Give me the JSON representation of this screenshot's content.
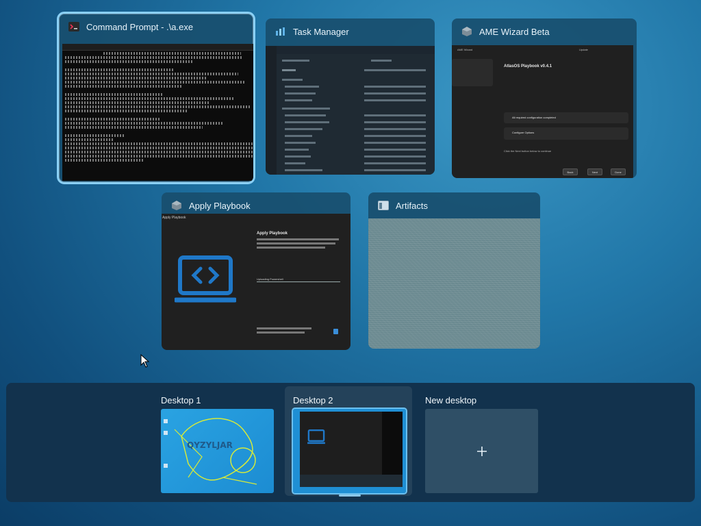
{
  "windows": {
    "cmd": {
      "title": "Command Prompt - .\\a.exe",
      "icon": "terminal-icon"
    },
    "task_manager": {
      "title": "Task Manager",
      "icon": "task-manager-icon"
    },
    "ame": {
      "title": "AME Wizard Beta",
      "icon": "ame-wizard-icon",
      "content": {
        "app_label": "AME Wizard",
        "update_label": "Update",
        "playbook_title": "AtlasOS Playbook v0.4.1",
        "requirements_ok": "All required configuration completed",
        "configure_options": "Configure Options",
        "start_hint": "Click the Next button below to continue",
        "back_label": "Back",
        "next_label": "Next",
        "done_label": "Done"
      }
    },
    "apply": {
      "title": "Apply Playbook",
      "icon": "ame-wizard-icon",
      "content": {
        "window_label": "Apply Playbook",
        "heading": "Apply Playbook",
        "status": "Uploading Powershell",
        "code_icon": "laptop-code-icon"
      }
    },
    "artifacts": {
      "title": "Artifacts",
      "icon": "window-icon"
    }
  },
  "desktops": {
    "items": [
      {
        "label": "Desktop 1",
        "wallpaper_text": "QYZYLJAR"
      },
      {
        "label": "Desktop 2"
      },
      {
        "label": "New desktop",
        "icon": "plus-icon"
      }
    ]
  },
  "colors": {
    "accent": "#6cc0ef",
    "bar_bg": "#12324d",
    "apply_icon_blue": "#1f78c8"
  }
}
